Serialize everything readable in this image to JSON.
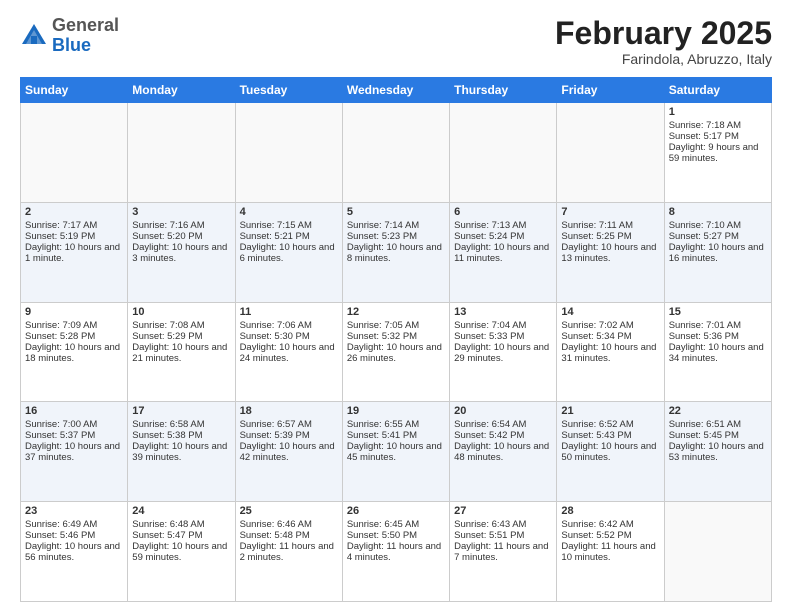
{
  "header": {
    "logo_general": "General",
    "logo_blue": "Blue",
    "month_title": "February 2025",
    "location": "Farindola, Abruzzo, Italy"
  },
  "days_of_week": [
    "Sunday",
    "Monday",
    "Tuesday",
    "Wednesday",
    "Thursday",
    "Friday",
    "Saturday"
  ],
  "weeks": [
    [
      {
        "day": "",
        "info": ""
      },
      {
        "day": "",
        "info": ""
      },
      {
        "day": "",
        "info": ""
      },
      {
        "day": "",
        "info": ""
      },
      {
        "day": "",
        "info": ""
      },
      {
        "day": "",
        "info": ""
      },
      {
        "day": "1",
        "info": "Sunrise: 7:18 AM\nSunset: 5:17 PM\nDaylight: 9 hours and 59 minutes."
      }
    ],
    [
      {
        "day": "2",
        "info": "Sunrise: 7:17 AM\nSunset: 5:19 PM\nDaylight: 10 hours and 1 minute."
      },
      {
        "day": "3",
        "info": "Sunrise: 7:16 AM\nSunset: 5:20 PM\nDaylight: 10 hours and 3 minutes."
      },
      {
        "day": "4",
        "info": "Sunrise: 7:15 AM\nSunset: 5:21 PM\nDaylight: 10 hours and 6 minutes."
      },
      {
        "day": "5",
        "info": "Sunrise: 7:14 AM\nSunset: 5:23 PM\nDaylight: 10 hours and 8 minutes."
      },
      {
        "day": "6",
        "info": "Sunrise: 7:13 AM\nSunset: 5:24 PM\nDaylight: 10 hours and 11 minutes."
      },
      {
        "day": "7",
        "info": "Sunrise: 7:11 AM\nSunset: 5:25 PM\nDaylight: 10 hours and 13 minutes."
      },
      {
        "day": "8",
        "info": "Sunrise: 7:10 AM\nSunset: 5:27 PM\nDaylight: 10 hours and 16 minutes."
      }
    ],
    [
      {
        "day": "9",
        "info": "Sunrise: 7:09 AM\nSunset: 5:28 PM\nDaylight: 10 hours and 18 minutes."
      },
      {
        "day": "10",
        "info": "Sunrise: 7:08 AM\nSunset: 5:29 PM\nDaylight: 10 hours and 21 minutes."
      },
      {
        "day": "11",
        "info": "Sunrise: 7:06 AM\nSunset: 5:30 PM\nDaylight: 10 hours and 24 minutes."
      },
      {
        "day": "12",
        "info": "Sunrise: 7:05 AM\nSunset: 5:32 PM\nDaylight: 10 hours and 26 minutes."
      },
      {
        "day": "13",
        "info": "Sunrise: 7:04 AM\nSunset: 5:33 PM\nDaylight: 10 hours and 29 minutes."
      },
      {
        "day": "14",
        "info": "Sunrise: 7:02 AM\nSunset: 5:34 PM\nDaylight: 10 hours and 31 minutes."
      },
      {
        "day": "15",
        "info": "Sunrise: 7:01 AM\nSunset: 5:36 PM\nDaylight: 10 hours and 34 minutes."
      }
    ],
    [
      {
        "day": "16",
        "info": "Sunrise: 7:00 AM\nSunset: 5:37 PM\nDaylight: 10 hours and 37 minutes."
      },
      {
        "day": "17",
        "info": "Sunrise: 6:58 AM\nSunset: 5:38 PM\nDaylight: 10 hours and 39 minutes."
      },
      {
        "day": "18",
        "info": "Sunrise: 6:57 AM\nSunset: 5:39 PM\nDaylight: 10 hours and 42 minutes."
      },
      {
        "day": "19",
        "info": "Sunrise: 6:55 AM\nSunset: 5:41 PM\nDaylight: 10 hours and 45 minutes."
      },
      {
        "day": "20",
        "info": "Sunrise: 6:54 AM\nSunset: 5:42 PM\nDaylight: 10 hours and 48 minutes."
      },
      {
        "day": "21",
        "info": "Sunrise: 6:52 AM\nSunset: 5:43 PM\nDaylight: 10 hours and 50 minutes."
      },
      {
        "day": "22",
        "info": "Sunrise: 6:51 AM\nSunset: 5:45 PM\nDaylight: 10 hours and 53 minutes."
      }
    ],
    [
      {
        "day": "23",
        "info": "Sunrise: 6:49 AM\nSunset: 5:46 PM\nDaylight: 10 hours and 56 minutes."
      },
      {
        "day": "24",
        "info": "Sunrise: 6:48 AM\nSunset: 5:47 PM\nDaylight: 10 hours and 59 minutes."
      },
      {
        "day": "25",
        "info": "Sunrise: 6:46 AM\nSunset: 5:48 PM\nDaylight: 11 hours and 2 minutes."
      },
      {
        "day": "26",
        "info": "Sunrise: 6:45 AM\nSunset: 5:50 PM\nDaylight: 11 hours and 4 minutes."
      },
      {
        "day": "27",
        "info": "Sunrise: 6:43 AM\nSunset: 5:51 PM\nDaylight: 11 hours and 7 minutes."
      },
      {
        "day": "28",
        "info": "Sunrise: 6:42 AM\nSunset: 5:52 PM\nDaylight: 11 hours and 10 minutes."
      },
      {
        "day": "",
        "info": ""
      }
    ]
  ]
}
